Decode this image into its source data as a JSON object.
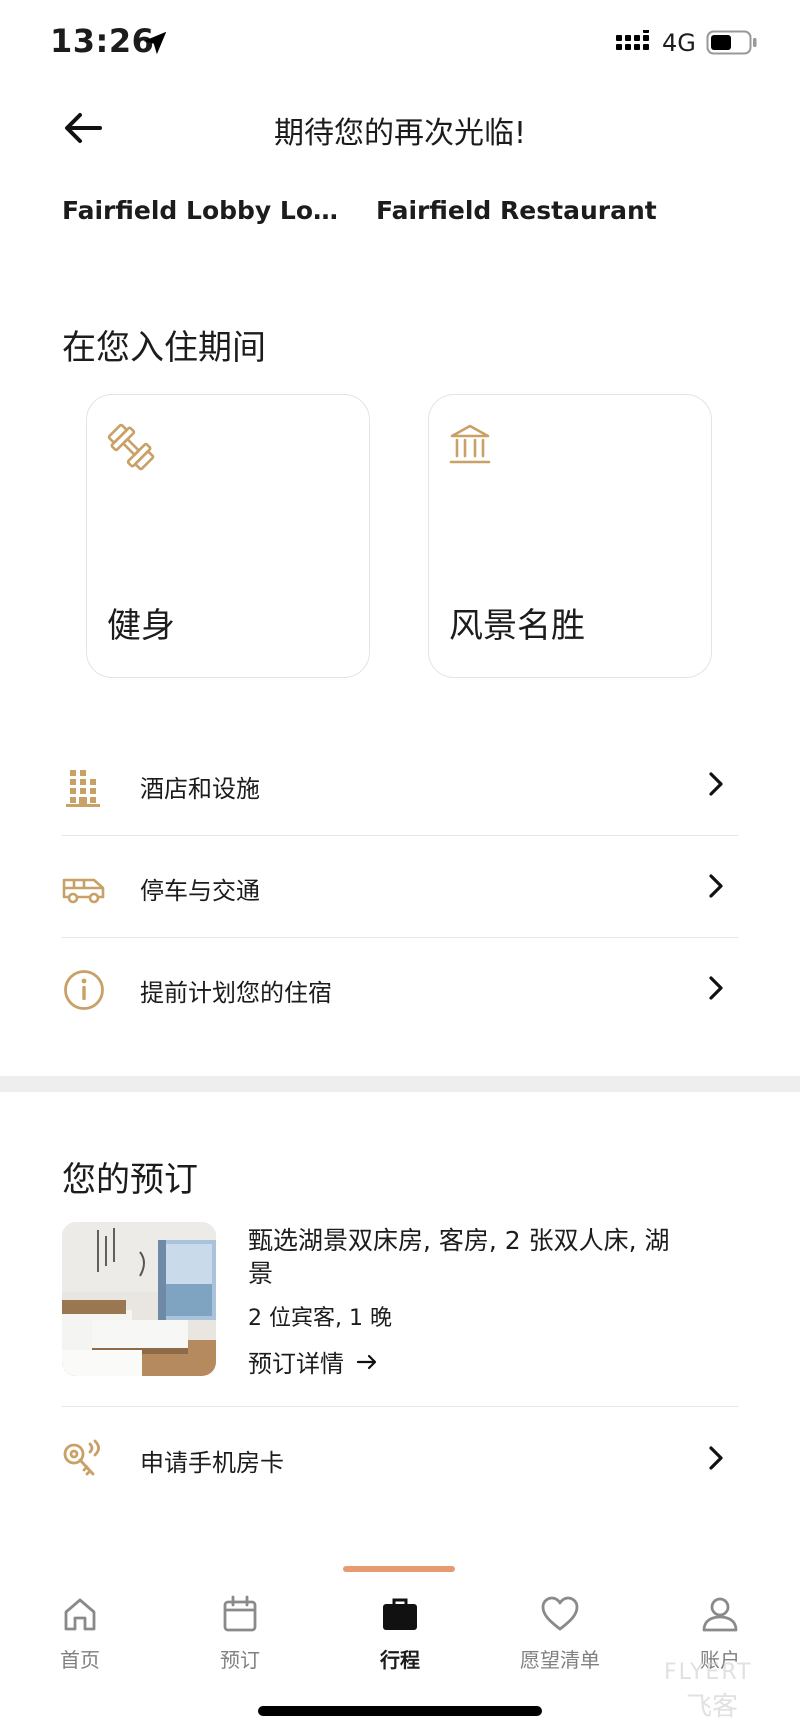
{
  "status_bar": {
    "time": "13:26",
    "network": "4G"
  },
  "header": {
    "title": "期待您的再次光临!"
  },
  "outlets": [
    "Fairfield Lobby Lounge",
    "Fairfield Restaurant"
  ],
  "during_stay": {
    "title": "在您入住期间",
    "cards": [
      {
        "label": "健身",
        "icon": "dumbbell-icon"
      },
      {
        "label": "风景名胜",
        "icon": "landmark-icon"
      }
    ]
  },
  "info_list": [
    {
      "label": "酒店和设施",
      "icon": "building-icon"
    },
    {
      "label": "停车与交通",
      "icon": "shuttle-van-icon"
    },
    {
      "label": "提前计划您的住宿",
      "icon": "info-icon"
    }
  ],
  "reservation": {
    "title": "您的预订",
    "room_name": "甄选湖景双床房, 客房, 2 张双人床, 湖景",
    "guests": "2 位宾客, 1 晚",
    "details_link": "预订详情",
    "mobile_key": "申请手机房卡"
  },
  "tabs": [
    {
      "label": "首页",
      "icon": "home-icon",
      "active": false
    },
    {
      "label": "预订",
      "icon": "calendar-icon",
      "active": false
    },
    {
      "label": "行程",
      "icon": "briefcase-icon",
      "active": true
    },
    {
      "label": "愿望清单",
      "icon": "heart-icon",
      "active": false
    },
    {
      "label": "账户",
      "icon": "person-icon",
      "active": false
    }
  ],
  "watermark": {
    "line1": "FLYERT",
    "line2": "飞客"
  },
  "colors": {
    "accent_gold": "#c9a066",
    "tab_indicator": "#e89a72",
    "divider": "#e6e6e6",
    "section_band": "#eeeeee",
    "inactive_tab": "#808080"
  }
}
